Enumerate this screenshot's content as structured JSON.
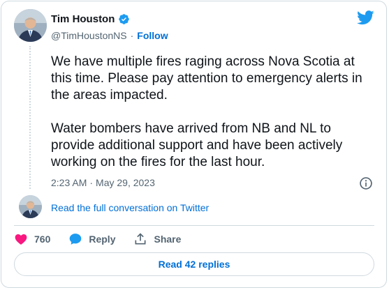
{
  "user": {
    "name": "Tim Houston",
    "handle": "@TimHoustonNS",
    "separator": "·",
    "follow_label": "Follow"
  },
  "tweet": {
    "paragraphs": [
      "We have multiple fires raging across Nova Scotia at this time. Please pay attention to emergency alerts in the areas impacted.",
      "Water bombers have arrived from NB and NL to provide additional support and have been actively working on the fires for the last hour."
    ],
    "time": "2:23 AM",
    "separator": "·",
    "date": "May 29, 2023"
  },
  "conversation": {
    "link_label": "Read the full conversation on Twitter"
  },
  "actions": {
    "likes_count": "760",
    "reply_label": "Reply",
    "share_label": "Share"
  },
  "replies": {
    "button_label": "Read 42 replies"
  },
  "colors": {
    "accent": "#006fd6",
    "verified": "#1d9bf0",
    "twitter_logo": "#1d9bf0",
    "like": "#f91880",
    "reply_bubble": "#1d9bf0",
    "text_secondary": "#536471",
    "border": "#cfd9de"
  },
  "icons": {
    "verified": "verified-badge-icon",
    "logo": "twitter-bird-icon",
    "info": "info-icon",
    "like": "heart-icon",
    "reply": "speech-bubble-icon",
    "share": "share-upload-icon"
  }
}
